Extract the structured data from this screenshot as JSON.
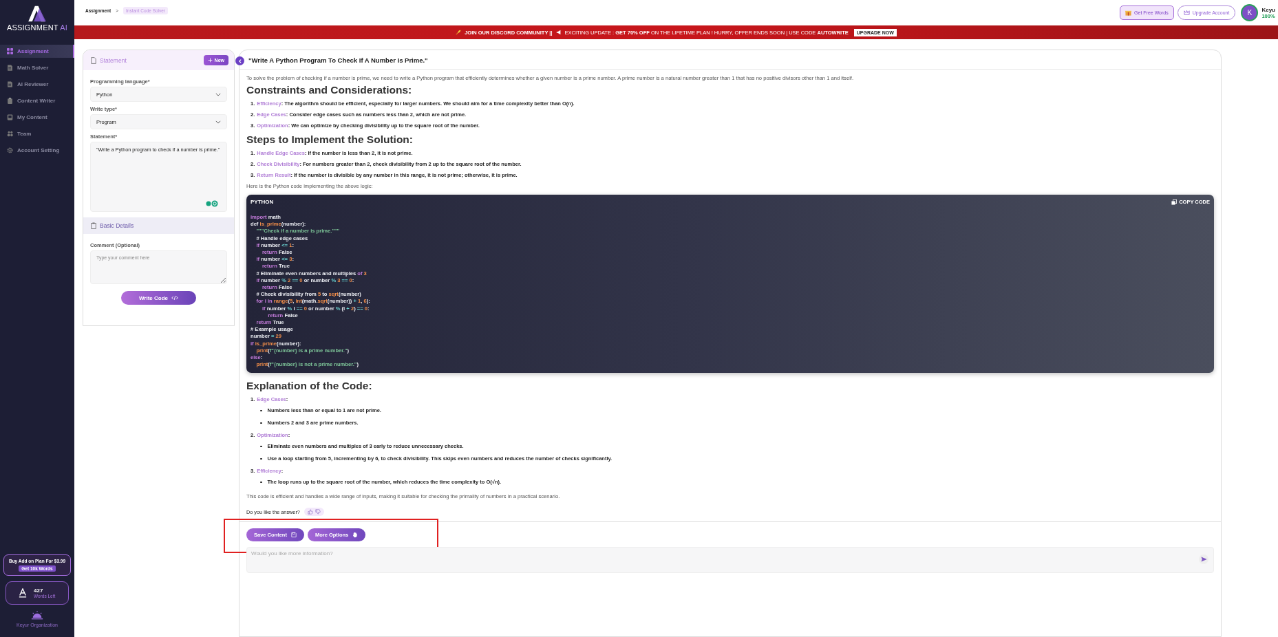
{
  "brand": {
    "name": "ASSIGNMENT",
    "suffix": "AI"
  },
  "sidebar": {
    "items": [
      {
        "label": "Assignment",
        "kind": "grid",
        "selected": true
      },
      {
        "label": "Math Solver",
        "kind": "doc",
        "selected": false
      },
      {
        "label": "AI Reviewer",
        "kind": "file",
        "selected": false
      },
      {
        "label": "Content Writer",
        "kind": "clipboard",
        "selected": false
      },
      {
        "label": "My Content",
        "kind": "book",
        "selected": false
      },
      {
        "label": "Team",
        "kind": "people",
        "selected": false
      },
      {
        "label": "Account Setting",
        "kind": "gear",
        "selected": false
      }
    ],
    "promo": {
      "text": "Buy Add on Plan For $3.99",
      "button": "Get 10k Words"
    },
    "words": {
      "count": "427",
      "label": "Words Left"
    },
    "organization": "Keyur Organization"
  },
  "breadcrumb": [
    "Assignment",
    ">",
    "Instant Code Solver"
  ],
  "topbar": {
    "free_words": "Get Free Words",
    "upgrade": "Upgrade Account",
    "avatar": "K",
    "user": "Keyu",
    "percent": "100%"
  },
  "banner": {
    "lead": "JOIN OUR DISCORD COMMUNITY ||",
    "text": "EXCITING UPDATE : **GET 70% OFF** ON THE LIFETIME PLAN ! HURRY, OFFER ENDS SOON | USE CODE **AUTOWRITE**",
    "button": "UPGRADE NOW"
  },
  "form": {
    "statement_title": "Statement",
    "new_button": "New",
    "language_label": "Programming language*",
    "language": "Python",
    "type_label": "Write type*",
    "type": "Program",
    "statement_label": "Statement*",
    "statement": "\"Write a Python program to check if a number is prime.\"",
    "details_title": "Basic Details",
    "comment_label": "Comment (Optional)",
    "comment_placeholder": "Type your comment here",
    "submit": "Write Code"
  },
  "answer": {
    "title": "\"Write A Python Program To Check If A Number Is Prime.\"",
    "intro": "To solve the problem of checking if a number is prime, we need to write a Python program that efficiently determines whether a given number is a prime number. A prime number is a natural number greater than 1 that has no positive divisors other than 1 and itself.",
    "sections": [
      {
        "heading": "Constraints and Considerations:",
        "items": [
          {
            "n": "1.",
            "term": "Efficiency",
            "text": ": The algorithm should be efficient, especially for larger numbers. We should aim for a time complexity better than O(n)."
          },
          {
            "n": "2.",
            "term": "Edge Cases",
            "text": ": Consider edge cases such as numbers less than 2, which are not prime."
          },
          {
            "n": "3.",
            "term": "Optimization",
            "text": ": We can optimize by checking divisibility up to the square root of the number."
          }
        ]
      },
      {
        "heading": "Steps to Implement the Solution:",
        "items": [
          {
            "n": "1.",
            "term": "Handle Edge Cases",
            "text": ": If the number is less than 2, it is not prime."
          },
          {
            "n": "2.",
            "term": "Check Divisibility",
            "text": ": For numbers greater than 2, check divisibility from 2 up to the square root of the number."
          },
          {
            "n": "3.",
            "term": "Return Result",
            "text": ": If the number is divisible by any number in this range, it is not prime; otherwise, it is prime."
          }
        ]
      }
    ],
    "code_intro": "Here is the Python code implementing the above logic:",
    "code": {
      "language": "PYTHON",
      "copy": "COPY CODE",
      "lines": [
        [
          {
            "kind": "kw",
            "text": "import"
          },
          {
            "kind": "txt",
            "text": " math"
          }
        ],
        [
          {
            "kind": "txt",
            "text": "def "
          },
          {
            "kind": "fn",
            "text": "is_prime"
          },
          {
            "kind": "txt",
            "text": "(number):"
          }
        ],
        [
          {
            "kind": "str",
            "text": "    \"\"\"Check if a number is prime.\"\"\""
          }
        ],
        [
          {
            "kind": "txt",
            "text": "    # Handle edge cases"
          }
        ],
        [
          {
            "kind": "kw",
            "text": "    if"
          },
          {
            "kind": "txt",
            "text": " number "
          },
          {
            "kind": "op",
            "text": "<="
          },
          {
            "kind": "num",
            "text": " 1"
          },
          {
            "kind": "txt",
            "text": ":"
          }
        ],
        [
          {
            "kind": "kw",
            "text": "        return"
          },
          {
            "kind": "txt",
            "text": " False"
          }
        ],
        [
          {
            "kind": "kw",
            "text": "    if"
          },
          {
            "kind": "txt",
            "text": " number "
          },
          {
            "kind": "op",
            "text": "<="
          },
          {
            "kind": "num",
            "text": " 3"
          },
          {
            "kind": "txt",
            "text": ":"
          }
        ],
        [
          {
            "kind": "kw",
            "text": "        return"
          },
          {
            "kind": "txt",
            "text": " True"
          }
        ],
        [
          {
            "kind": "txt",
            "text": "    # Eliminate even numbers and multiples "
          },
          {
            "kind": "kw",
            "text": "of"
          },
          {
            "kind": "num",
            "text": " 3"
          }
        ],
        [
          {
            "kind": "kw",
            "text": "    if"
          },
          {
            "kind": "txt",
            "text": " number "
          },
          {
            "kind": "op",
            "text": "%"
          },
          {
            "kind": "num",
            "text": " 2"
          },
          {
            "kind": "op",
            "text": " =="
          },
          {
            "kind": "num",
            "text": " 0"
          },
          {
            "kind": "txt",
            "text": " or number "
          },
          {
            "kind": "op",
            "text": "%"
          },
          {
            "kind": "num",
            "text": " 3"
          },
          {
            "kind": "op",
            "text": " =="
          },
          {
            "kind": "num",
            "text": " 0"
          },
          {
            "kind": "txt",
            "text": ":"
          }
        ],
        [
          {
            "kind": "kw",
            "text": "        return"
          },
          {
            "kind": "txt",
            "text": " False"
          }
        ],
        [
          {
            "kind": "txt",
            "text": "    # Check divisibility from "
          },
          {
            "kind": "num",
            "text": "5"
          },
          {
            "kind": "txt",
            "text": " to "
          },
          {
            "kind": "fn",
            "text": "sqrt"
          },
          {
            "kind": "txt",
            "text": "(number)"
          }
        ],
        [
          {
            "kind": "kw",
            "text": "    for i in"
          },
          {
            "kind": "fn",
            "text": " range"
          },
          {
            "kind": "txt",
            "text": "("
          },
          {
            "kind": "num",
            "text": "5"
          },
          {
            "kind": "txt",
            "text": ", "
          },
          {
            "kind": "fn",
            "text": "int"
          },
          {
            "kind": "txt",
            "text": "(math."
          },
          {
            "kind": "fn",
            "text": "sqrt"
          },
          {
            "kind": "txt",
            "text": "(number)) "
          },
          {
            "kind": "op",
            "text": "+"
          },
          {
            "kind": "num",
            "text": " 1"
          },
          {
            "kind": "txt",
            "text": ", "
          },
          {
            "kind": "num",
            "text": "6"
          },
          {
            "kind": "txt",
            "text": "):"
          }
        ],
        [
          {
            "kind": "kw",
            "text": "        if"
          },
          {
            "kind": "txt",
            "text": " number "
          },
          {
            "kind": "op",
            "text": "%"
          },
          {
            "kind": "txt",
            "text": " i "
          },
          {
            "kind": "op",
            "text": "=="
          },
          {
            "kind": "num",
            "text": " 0"
          },
          {
            "kind": "txt",
            "text": " or number "
          },
          {
            "kind": "op",
            "text": "%"
          },
          {
            "kind": "txt",
            "text": " (i "
          },
          {
            "kind": "op",
            "text": "+"
          },
          {
            "kind": "num",
            "text": " 2"
          },
          {
            "kind": "txt",
            "text": ") "
          },
          {
            "kind": "op",
            "text": "=="
          },
          {
            "kind": "num",
            "text": " 0"
          },
          {
            "kind": "txt",
            "text": ":"
          }
        ],
        [
          {
            "kind": "kw",
            "text": "            return"
          },
          {
            "kind": "txt",
            "text": " False"
          }
        ],
        [
          {
            "kind": "kw",
            "text": "    return"
          },
          {
            "kind": "txt",
            "text": " True"
          }
        ],
        [
          {
            "kind": "txt",
            "text": "# Example usage"
          }
        ],
        [
          {
            "kind": "txt",
            "text": "number "
          },
          {
            "kind": "op",
            "text": "="
          },
          {
            "kind": "num",
            "text": " 29"
          }
        ],
        [
          {
            "kind": "kw",
            "text": "if"
          },
          {
            "kind": "fn",
            "text": " is_prime"
          },
          {
            "kind": "txt",
            "text": "(number):"
          }
        ],
        [
          {
            "kind": "fn",
            "text": "    print"
          },
          {
            "kind": "txt",
            "text": "("
          },
          {
            "kind": "str",
            "text": "f\"{number} is a prime number.\""
          },
          {
            "kind": "txt",
            "text": ")"
          }
        ],
        [
          {
            "kind": "kw",
            "text": "else"
          },
          {
            "kind": "txt",
            "text": ":"
          }
        ],
        [
          {
            "kind": "fn",
            "text": "    print"
          },
          {
            "kind": "txt",
            "text": "("
          },
          {
            "kind": "str",
            "text": "f\"{number} is not a prime number.\""
          },
          {
            "kind": "txt",
            "text": ")"
          }
        ]
      ]
    },
    "explanation": {
      "heading": "Explanation of the Code:",
      "items": [
        {
          "n": "1.",
          "term": "Edge Cases",
          "text": ":",
          "bullets": [
            "Numbers less than or equal to 1 are not prime.",
            "Numbers 2 and 3 are prime numbers."
          ]
        },
        {
          "n": "2.",
          "term": "Optimization",
          "text": ":",
          "bullets": [
            "Eliminate even numbers and multiples of 3 early to reduce unnecessary checks.",
            "Use a loop starting from 5, incrementing by 6, to check divisibility. This skips even numbers and reduces the number of checks significantly."
          ]
        },
        {
          "n": "3.",
          "term": "Efficiency",
          "text": ":",
          "bullets": [
            "The loop runs up to the square root of the number, which reduces the time complexity to O(√n)."
          ]
        }
      ]
    },
    "conclusion": "This code is efficient and handles a wide range of inputs, making it suitable for checking the primality of numbers in a practical scenario.",
    "feedback_question": "Do you like the answer?",
    "save_button": "Save Content",
    "more_button": "More Options",
    "followup_placeholder": "Would you like more information?"
  }
}
